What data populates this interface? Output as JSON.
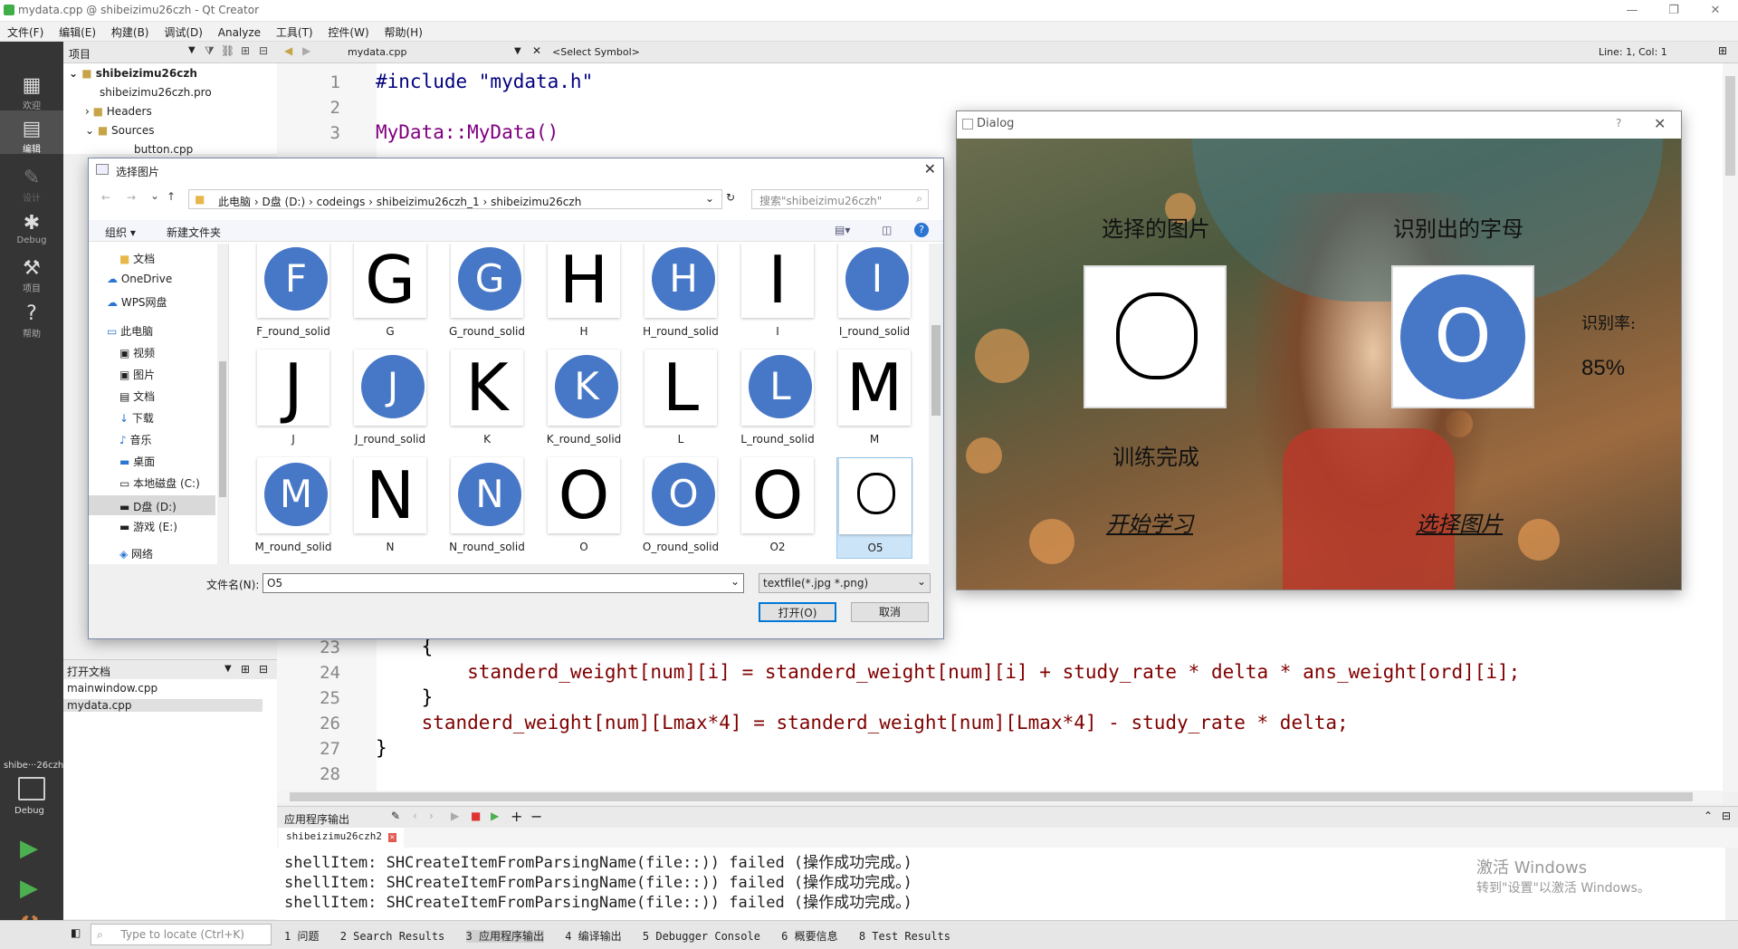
{
  "window": {
    "title": "mydata.cpp @ shibeizimu26czh - Qt Creator"
  },
  "menu": [
    "文件(F)",
    "编辑(E)",
    "构建(B)",
    "调试(D)",
    "Analyze",
    "工具(T)",
    "控件(W)",
    "帮助(H)"
  ],
  "modes": [
    {
      "label": "欢迎",
      "icon": "grid-icon"
    },
    {
      "label": "编辑",
      "icon": "edit-icon"
    },
    {
      "label": "设计",
      "icon": "pencil-icon"
    },
    {
      "label": "Debug",
      "icon": "bug-icon"
    },
    {
      "label": "项目",
      "icon": "wrench-icon"
    },
    {
      "label": "帮助",
      "icon": "help-icon"
    }
  ],
  "kit": {
    "label": "shibe···26czh",
    "mode": "Debug"
  },
  "project_pane": {
    "header": "项目",
    "tree": [
      "shibeizimu26czh",
      "shibeizimu26czh.pro",
      "Headers",
      "Sources",
      "button.cpp"
    ]
  },
  "editor": {
    "file": "mydata.cpp",
    "symbol": "<Select Symbol>",
    "position": "Line: 1, Col: 1",
    "lines_top": [
      {
        "n": "1",
        "text": "#include \"mydata.h\""
      },
      {
        "n": "2",
        "text": ""
      },
      {
        "n": "3",
        "text": "MyData::MyData()"
      }
    ],
    "lines_bottom": [
      {
        "n": "23",
        "text": "    {"
      },
      {
        "n": "24",
        "text": "        standerd_weight[num][i] = standerd_weight[num][i] + study_rate * delta * ans_weight[ord][i];"
      },
      {
        "n": "25",
        "text": "    }"
      },
      {
        "n": "26",
        "text": "    standerd_weight[num][Lmax*4] = standerd_weight[num][Lmax*4] - study_rate * delta;"
      },
      {
        "n": "27",
        "text": "}"
      },
      {
        "n": "28",
        "text": ""
      }
    ]
  },
  "open_docs": {
    "header": "打开文档",
    "items": [
      "mainwindow.cpp",
      "mydata.cpp"
    ]
  },
  "output": {
    "header": "应用程序输出",
    "tab": "shibeizimu26czh2",
    "lines": [
      "shellItem: SHCreateItemFromParsingName(file::)) failed (操作成功完成。)",
      "shellItem: SHCreateItemFromParsingName(file::)) failed (操作成功完成。)",
      "shellItem: SHCreateItemFromParsingName(file::)) failed (操作成功完成。)"
    ],
    "watermark_1": "激活 Windows",
    "watermark_2": "转到\"设置\"以激活 Windows。"
  },
  "statusbar": {
    "locate_placeholder": "Type to locate (Ctrl+K)",
    "tabs": [
      "1 问题",
      "2 Search Results",
      "3 应用程序输出",
      "4 编译输出",
      "5 Debugger Console",
      "6 概要信息",
      "8 Test Results"
    ]
  },
  "file_dialog": {
    "title": "选择图片",
    "breadcrumbs": [
      "此电脑",
      "D盘 (D:)",
      "codeings",
      "shibeizimu26czh_1",
      "shibeizimu26czh"
    ],
    "search_placeholder": "搜索\"shibeizimu26czh\"",
    "organize": "组织 ▾",
    "new_folder": "新建文件夹",
    "nav": [
      "文档",
      "OneDrive",
      "WPS网盘",
      "此电脑",
      "视频",
      "图片",
      "文档",
      "下载",
      "音乐",
      "桌面",
      "本地磁盘 (C:)",
      "D盘 (D:)",
      "游戏 (E:)",
      "网络"
    ],
    "nav_selected": "D盘 (D:)",
    "files": [
      {
        "name": "F_round_solid",
        "glyph": "F",
        "round": true
      },
      {
        "name": "G",
        "glyph": "G",
        "round": false
      },
      {
        "name": "G_round_solid",
        "glyph": "G",
        "round": true
      },
      {
        "name": "H",
        "glyph": "H",
        "round": false
      },
      {
        "name": "H_round_solid",
        "glyph": "H",
        "round": true
      },
      {
        "name": "I",
        "glyph": "I",
        "round": false
      },
      {
        "name": "I_round_solid",
        "glyph": "I",
        "round": true
      },
      {
        "name": "J",
        "glyph": "J",
        "round": false
      },
      {
        "name": "J_round_solid",
        "glyph": "J",
        "round": true
      },
      {
        "name": "K",
        "glyph": "K",
        "round": false
      },
      {
        "name": "K_round_solid",
        "glyph": "K",
        "round": true
      },
      {
        "name": "L",
        "glyph": "L",
        "round": false
      },
      {
        "name": "L_round_solid",
        "glyph": "L",
        "round": true
      },
      {
        "name": "M",
        "glyph": "M",
        "round": false
      },
      {
        "name": "M_round_solid",
        "glyph": "M",
        "round": true
      },
      {
        "name": "N",
        "glyph": "N",
        "round": false
      },
      {
        "name": "N_round_solid",
        "glyph": "N",
        "round": true
      },
      {
        "name": "O",
        "glyph": "O",
        "round": false
      },
      {
        "name": "O_round_solid",
        "glyph": "O",
        "round": true
      },
      {
        "name": "O2",
        "glyph": "O",
        "round": false
      },
      {
        "name": "O5",
        "glyph": "O",
        "round": false,
        "selected": true
      }
    ],
    "filename_label": "文件名(N):",
    "filename_value": "O5",
    "filter": "textfile(*.jpg *.png)",
    "open": "打开(O)",
    "cancel": "取消"
  },
  "qt_dialog": {
    "title": "Dialog",
    "help": "?",
    "label_selected": "选择的图片",
    "label_recognized": "识别出的字母",
    "recognized_letter": "O",
    "rate_label": "识别率:",
    "rate_value": "85%",
    "status": "训练完成",
    "start_btn": "开始学习",
    "select_btn": "选择图片"
  }
}
